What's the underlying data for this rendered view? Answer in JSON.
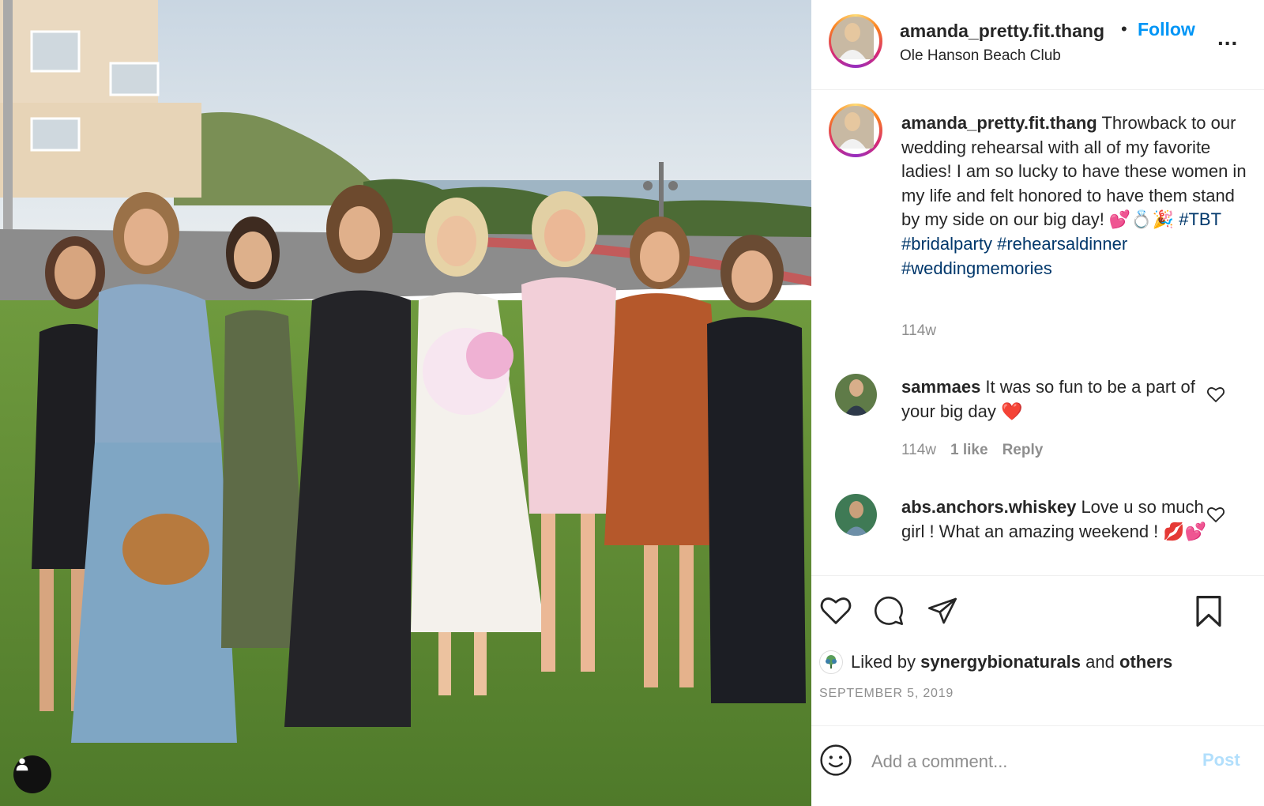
{
  "post": {
    "username": "amanda_pretty.fit.thang",
    "follow_label": "Follow",
    "separator": "•",
    "location": "Ole Hanson Beach Club",
    "more_label": "...",
    "caption": {
      "username": "amanda_pretty.fit.thang",
      "text": " Throwback to our wedding rehearsal with all of my favorite ladies! I am so lucky to have these women in my life and felt honored to have them stand by my side on our big day! 💕💍🎉 ",
      "hashtags": [
        "#TBT",
        "#bridalparty",
        "#rehearsaldinner",
        "#weddingmemories"
      ],
      "time": "114w"
    },
    "comments": [
      {
        "username": "sammaes",
        "text": " It was so fun to be a part of your big day ❤️",
        "time": "114w",
        "likes": "1 like",
        "reply_label": "Reply"
      },
      {
        "username": "abs.anchors.whiskey",
        "text": " Love u so much girl ! What an amazing weekend ! 💋💕"
      }
    ],
    "liked_by": {
      "prefix": "Liked by ",
      "user": "synergybionaturals",
      "middle": " and ",
      "others": "others"
    },
    "date": "SEPTEMBER 5, 2019",
    "add_comment_placeholder": "Add a comment...",
    "post_label": "Post"
  },
  "icons": {
    "like": "heart-icon",
    "comment": "comment-bubble-icon",
    "share": "paper-plane-icon",
    "save": "bookmark-icon",
    "emoji": "smiley-icon",
    "tag": "user-tag-icon"
  },
  "colors": {
    "accent": "#0095f6",
    "hashtag": "#00376b",
    "muted": "#8e8e8e",
    "post_disabled": "#b2dffc",
    "heart_red": "#ed4956"
  }
}
